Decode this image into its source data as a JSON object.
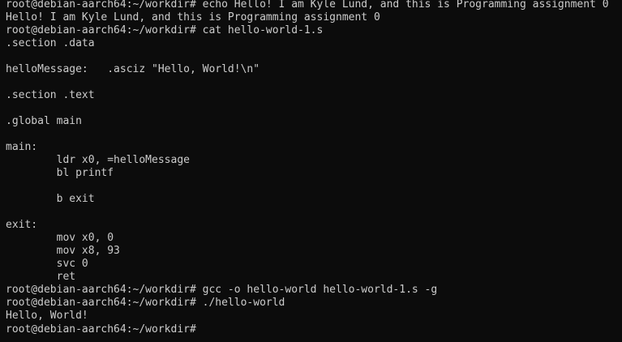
{
  "terminal": {
    "background": "#0c0c0c",
    "foreground": "#cccccc",
    "lines": [
      "root@debian-aarch64:~/workdir# echo Hello! I am Kyle Lund, and this is Programming assignment 0",
      "Hello! I am Kyle Lund, and this is Programming assignment 0",
      "root@debian-aarch64:~/workdir# cat hello-world-1.s",
      ".section .data",
      "",
      "helloMessage:   .asciz \"Hello, World!\\n\"",
      "",
      ".section .text",
      "",
      ".global main",
      "",
      "main:",
      "        ldr x0, =helloMessage",
      "        bl printf",
      "",
      "        b exit",
      "",
      "exit:",
      "        mov x0, 0",
      "        mov x8, 93",
      "        svc 0",
      "        ret",
      "root@debian-aarch64:~/workdir# gcc -o hello-world hello-world-1.s -g",
      "root@debian-aarch64:~/workdir# ./hello-world",
      "Hello, World!",
      "root@debian-aarch64:~/workdir# "
    ]
  }
}
